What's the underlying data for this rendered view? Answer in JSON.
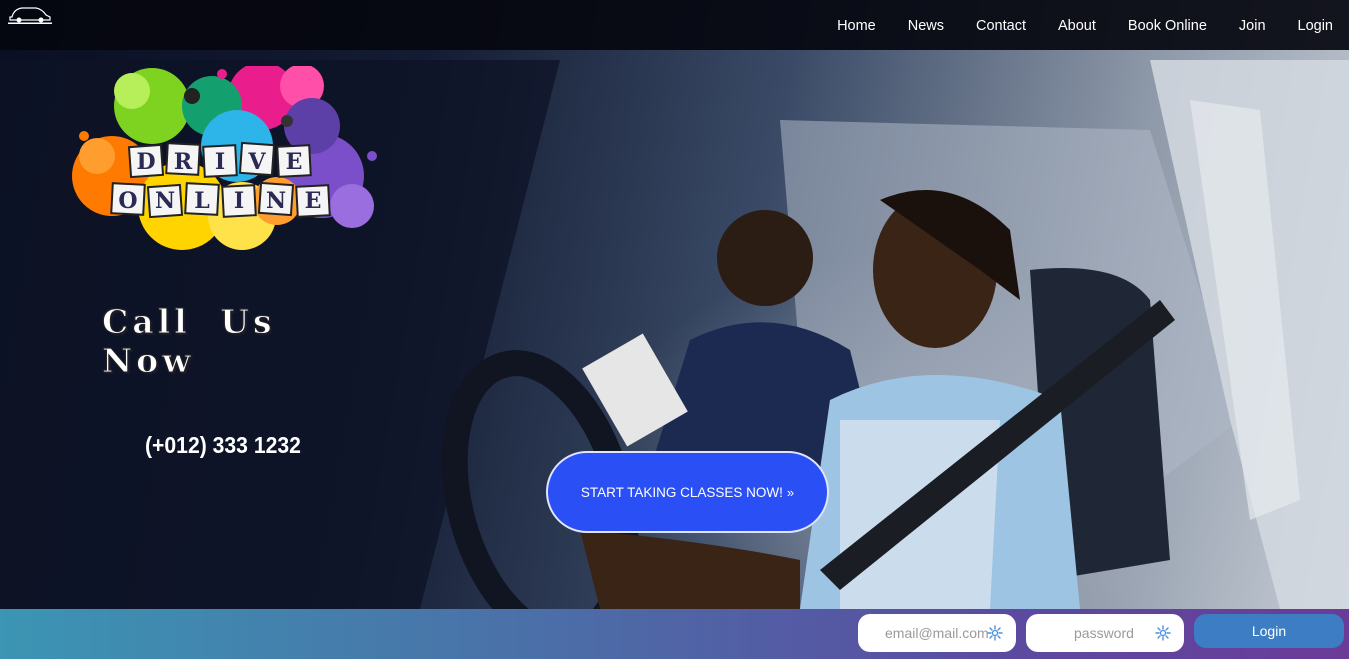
{
  "nav": {
    "items": [
      {
        "label": "Home"
      },
      {
        "label": "News"
      },
      {
        "label": "Contact"
      },
      {
        "label": "About"
      },
      {
        "label": "Book Online"
      },
      {
        "label": "Join"
      },
      {
        "label": "Login"
      }
    ]
  },
  "brand": {
    "logo_text_line1": "DRIVE",
    "logo_text_line2": "ONLINE",
    "colors": [
      "#7ed321",
      "#e91e8c",
      "#ff7a00",
      "#ffd400",
      "#2db4e8",
      "#7b4fc9",
      "#14a06e"
    ]
  },
  "hero": {
    "call_us": "Call Us Now",
    "phone": "(+012) 333 1232",
    "cta_label": "START TAKING CLASSES NOW!",
    "cta_arrow": "»",
    "cta_color": "#2a4ff5"
  },
  "login_bar": {
    "email_placeholder": "email@mail.com",
    "password_placeholder": "password",
    "login_label": "Login",
    "field_icon": "gear-icon"
  }
}
